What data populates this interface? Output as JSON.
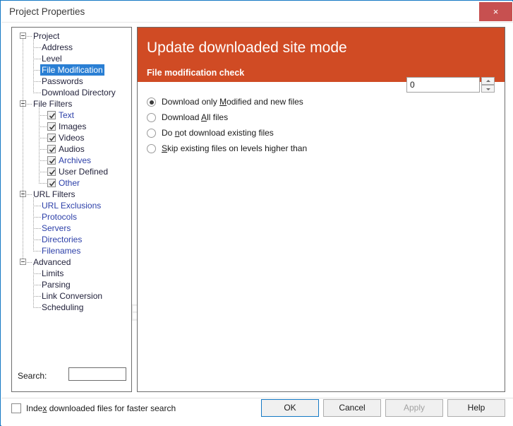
{
  "window": {
    "title": "Project Properties",
    "close_label": "×",
    "border_color": "#1479c4",
    "close_button_color": "#c75050"
  },
  "watermark": {
    "text": "SOFTPEDIA"
  },
  "tree": {
    "nodes": [
      {
        "label": "Project",
        "depth": 0,
        "expander": true,
        "checkbox": null,
        "selected": false,
        "color": "dark"
      },
      {
        "label": "Address",
        "depth": 1,
        "expander": false,
        "checkbox": null,
        "selected": false,
        "color": "dark"
      },
      {
        "label": "Level",
        "depth": 1,
        "expander": false,
        "checkbox": null,
        "selected": false,
        "color": "dark"
      },
      {
        "label": "File Modification",
        "depth": 1,
        "expander": false,
        "checkbox": null,
        "selected": true,
        "color": "dark"
      },
      {
        "label": "Passwords",
        "depth": 1,
        "expander": false,
        "checkbox": null,
        "selected": false,
        "color": "dark"
      },
      {
        "label": "Download Directory",
        "depth": 1,
        "expander": false,
        "checkbox": null,
        "selected": false,
        "color": "dark"
      },
      {
        "label": "File Filters",
        "depth": 0,
        "expander": true,
        "checkbox": null,
        "selected": false,
        "color": "dark"
      },
      {
        "label": "Text",
        "depth": 2,
        "expander": false,
        "checkbox": true,
        "selected": false,
        "color": "blue"
      },
      {
        "label": "Images",
        "depth": 2,
        "expander": false,
        "checkbox": true,
        "selected": false,
        "color": "dark"
      },
      {
        "label": "Videos",
        "depth": 2,
        "expander": false,
        "checkbox": true,
        "selected": false,
        "color": "dark"
      },
      {
        "label": "Audios",
        "depth": 2,
        "expander": false,
        "checkbox": true,
        "selected": false,
        "color": "dark"
      },
      {
        "label": "Archives",
        "depth": 2,
        "expander": false,
        "checkbox": true,
        "selected": false,
        "color": "blue"
      },
      {
        "label": "User Defined",
        "depth": 2,
        "expander": false,
        "checkbox": true,
        "selected": false,
        "color": "dark"
      },
      {
        "label": "Other",
        "depth": 2,
        "expander": false,
        "checkbox": true,
        "selected": false,
        "color": "blue"
      },
      {
        "label": "URL Filters",
        "depth": 0,
        "expander": true,
        "checkbox": null,
        "selected": false,
        "color": "dark"
      },
      {
        "label": "URL Exclusions",
        "depth": 1,
        "expander": false,
        "checkbox": null,
        "selected": false,
        "color": "blue"
      },
      {
        "label": "Protocols",
        "depth": 1,
        "expander": false,
        "checkbox": null,
        "selected": false,
        "color": "blue"
      },
      {
        "label": "Servers",
        "depth": 1,
        "expander": false,
        "checkbox": null,
        "selected": false,
        "color": "blue"
      },
      {
        "label": "Directories",
        "depth": 1,
        "expander": false,
        "checkbox": null,
        "selected": false,
        "color": "blue"
      },
      {
        "label": "Filenames",
        "depth": 1,
        "expander": false,
        "checkbox": null,
        "selected": false,
        "color": "blue"
      },
      {
        "label": "Advanced",
        "depth": 0,
        "expander": true,
        "checkbox": null,
        "selected": false,
        "color": "dark"
      },
      {
        "label": "Limits",
        "depth": 1,
        "expander": false,
        "checkbox": null,
        "selected": false,
        "color": "dark"
      },
      {
        "label": "Parsing",
        "depth": 1,
        "expander": false,
        "checkbox": null,
        "selected": false,
        "color": "dark"
      },
      {
        "label": "Link Conversion",
        "depth": 1,
        "expander": false,
        "checkbox": null,
        "selected": false,
        "color": "dark"
      },
      {
        "label": "Scheduling",
        "depth": 1,
        "expander": false,
        "checkbox": null,
        "selected": false,
        "color": "dark"
      }
    ],
    "selected_label": "File Modification",
    "selection_color": "#2a7fd4"
  },
  "search": {
    "label": "Search:",
    "value": "",
    "placeholder": ""
  },
  "banner": {
    "title": "Update downloaded site mode",
    "subtitle": "File modification check",
    "background": "#d04b24"
  },
  "options": {
    "group_name": "file-modification-check",
    "items": [
      {
        "id": "download-modified",
        "pre": "Download only ",
        "accel": "M",
        "post": "odified and new files",
        "full": "Download only Modified and new files",
        "checked": true
      },
      {
        "id": "download-all",
        "pre": "Download ",
        "accel": "A",
        "post": "ll files",
        "full": "Download All files",
        "checked": false
      },
      {
        "id": "do-not-download-existing",
        "pre": "Do ",
        "accel": "n",
        "post": "ot download existing files",
        "full": "Do not download existing files",
        "checked": false
      },
      {
        "id": "skip-existing-levels",
        "pre": "",
        "accel": "S",
        "post": "kip existing files on levels higher than",
        "full": "Skip existing files on levels higher than",
        "checked": false
      }
    ]
  },
  "level_spinner": {
    "value": "0",
    "placeholder": "",
    "up_icon": "spinner-up-arrow-icon",
    "down_icon": "spinner-down-arrow-icon"
  },
  "bottom": {
    "index_checkbox": {
      "pre": "Inde",
      "accel": "x",
      "post": " downloaded files for faster search",
      "full": "Index downloaded files for faster search",
      "checked": false
    },
    "buttons": [
      {
        "id": "ok",
        "label": "OK",
        "default": true,
        "disabled": false
      },
      {
        "id": "cancel",
        "label": "Cancel",
        "default": false,
        "disabled": false
      },
      {
        "id": "apply",
        "label": "Apply",
        "default": false,
        "disabled": true
      },
      {
        "id": "help",
        "label": "Help",
        "default": false,
        "disabled": false
      }
    ]
  }
}
